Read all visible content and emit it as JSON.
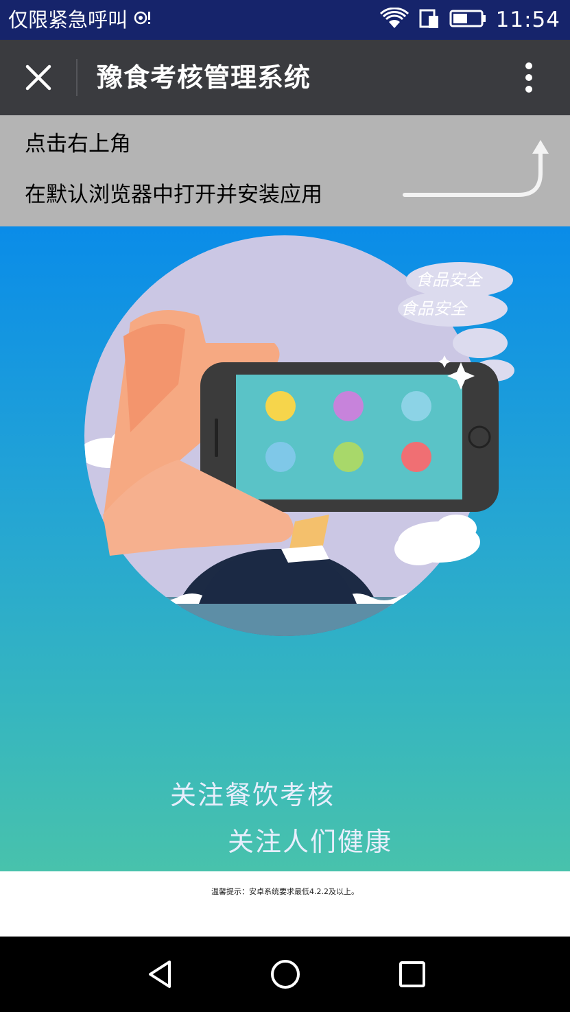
{
  "status_bar": {
    "carrier_text": "仅限紧急呼叫",
    "time": "11:54",
    "icons": [
      "hotspot-icon",
      "wifi-icon",
      "sim-icon",
      "battery-icon"
    ]
  },
  "title_bar": {
    "title": "豫食考核管理系统",
    "close_icon": "close-icon",
    "menu_icon": "more-vert-icon"
  },
  "hint": {
    "line1": "点击右上角",
    "line2": "在默认浏览器中打开并安装应用"
  },
  "hero": {
    "cloud_text1": "食品安全",
    "cloud_text2": "食品安全",
    "colors": {
      "top": "#0a8ce8",
      "bottom": "#48c2ac",
      "circle": "#cac7e3"
    }
  },
  "slogan": {
    "line1": "关注餐饮考核",
    "line2": "关注人们健康"
  },
  "footer": {
    "tip": "温馨提示：安卓系统要求最低4.2.2及以上。"
  },
  "nav_bar": {
    "back_icon": "back-triangle-icon",
    "home_icon": "home-circle-icon",
    "recents_icon": "recents-square-icon"
  }
}
